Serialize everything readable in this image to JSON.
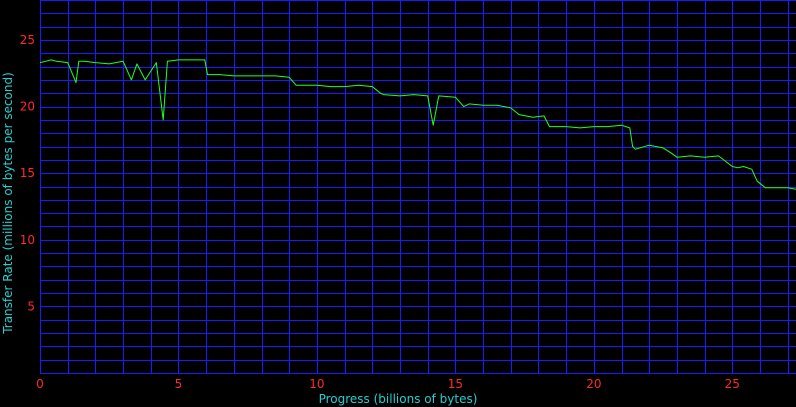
{
  "chart_data": {
    "type": "line",
    "xlabel": "Progress (billions of bytes)",
    "ylabel": "Transfer Rate (millions of bytes per second)",
    "xlim": [
      0,
      27.3
    ],
    "ylim": [
      0,
      28
    ],
    "x_ticks": [
      0,
      5,
      10,
      15,
      20,
      25
    ],
    "y_ticks": [
      5,
      10,
      15,
      20,
      25
    ],
    "x_tick_labels": [
      "0",
      "5",
      "10",
      "15",
      "20",
      "25"
    ],
    "y_tick_labels": [
      "5",
      "10",
      "15",
      "20",
      "25"
    ],
    "grid": true,
    "colors": {
      "background": "#000000",
      "grid": "#1a1aff",
      "series": "#22ff22",
      "tick_labels": "#ff2a2a",
      "axis_labels": "#22d0d0"
    },
    "series": [
      {
        "x": [
          0,
          0.2,
          0.4,
          0.6,
          1.0,
          1.3,
          1.4,
          1.6,
          2.0,
          2.5,
          3.0,
          3.3,
          3.5,
          3.8,
          4.2,
          4.45,
          4.6,
          5.0,
          5.5,
          5.95,
          6.05,
          6.5,
          7.0,
          7.5,
          8.0,
          8.5,
          9.0,
          9.25,
          9.4,
          10.0,
          10.5,
          11.0,
          11.5,
          12.0,
          12.3,
          12.4,
          13.0,
          13.5,
          14.0,
          14.2,
          14.4,
          15.0,
          15.3,
          15.5,
          16.0,
          16.5,
          17.0,
          17.3,
          17.8,
          18.2,
          18.4,
          19.0,
          19.5,
          20.0,
          20.5,
          21.0,
          21.3,
          21.4,
          21.5,
          22.0,
          22.5,
          22.8,
          23.0,
          23.5,
          24.0,
          24.5,
          25.0,
          25.2,
          25.4,
          25.7,
          25.9,
          26.2,
          26.6,
          27.0,
          27.3
        ],
        "y": [
          23.3,
          23.4,
          23.5,
          23.4,
          23.3,
          21.8,
          23.4,
          23.4,
          23.3,
          23.2,
          23.4,
          22.0,
          23.2,
          22.0,
          23.3,
          19.0,
          23.4,
          23.5,
          23.5,
          23.5,
          22.4,
          22.4,
          22.3,
          22.3,
          22.3,
          22.3,
          22.2,
          21.6,
          21.6,
          21.6,
          21.5,
          21.5,
          21.6,
          21.5,
          21.0,
          20.9,
          20.8,
          20.9,
          20.8,
          18.6,
          20.8,
          20.7,
          20.0,
          20.2,
          20.1,
          20.1,
          19.9,
          19.4,
          19.2,
          19.3,
          18.5,
          18.5,
          18.4,
          18.5,
          18.5,
          18.6,
          18.4,
          17.0,
          16.8,
          17.1,
          16.9,
          16.5,
          16.2,
          16.3,
          16.2,
          16.3,
          15.5,
          15.4,
          15.5,
          15.3,
          14.4,
          13.9,
          13.9,
          13.9,
          13.8
        ]
      }
    ]
  }
}
